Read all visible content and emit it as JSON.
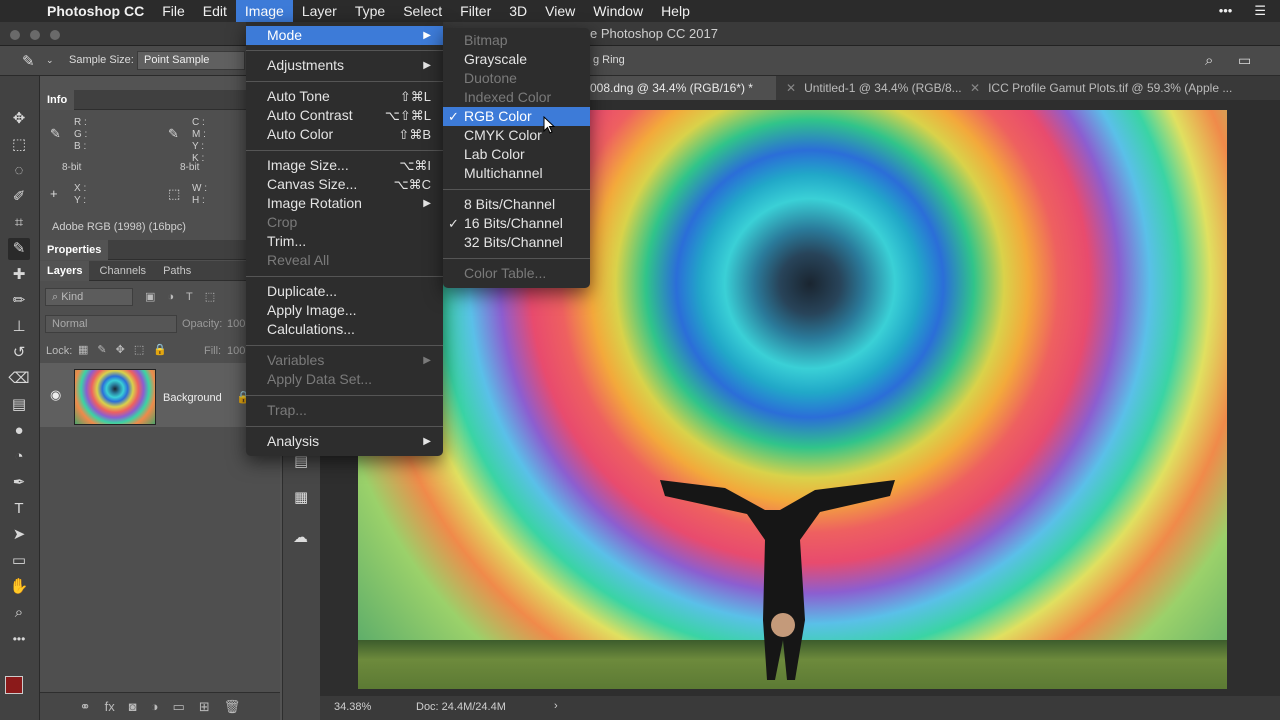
{
  "menubar": {
    "app": "Photoshop CC",
    "items": [
      "File",
      "Edit",
      "Image",
      "Layer",
      "Type",
      "Select",
      "Filter",
      "3D",
      "View",
      "Window",
      "Help"
    ],
    "active": "Image"
  },
  "titlebar": {
    "title": "e Photoshop CC 2017"
  },
  "options": {
    "sample_size_label": "Sample Size:",
    "sample_size_value": "Point Sample",
    "ring_label": "g Ring"
  },
  "tabs": [
    {
      "label": "008.dng @ 34.4% (RGB/16*) *",
      "active": true
    },
    {
      "label": "Untitled-1 @ 34.4% (RGB/8...",
      "active": false
    },
    {
      "label": "ICC Profile Gamut Plots.tif @ 59.3% (Apple ...",
      "active": false
    }
  ],
  "info_panel": {
    "tab": "Info",
    "rgb": "R :\nG :\nB :",
    "cmyk": "C :\nM :\nY :\nK :",
    "bit1": "8-bit",
    "bit2": "8-bit",
    "xy": "X :\nY :",
    "wh": "W :\nH :",
    "profile": "Adobe RGB (1998) (16bpc)"
  },
  "properties_tab": "Properties",
  "layers_panel": {
    "tabs": [
      "Layers",
      "Channels",
      "Paths"
    ],
    "kind_label": "Kind",
    "blend_mode": "Normal",
    "opacity_label": "Opacity:",
    "opacity_value": "100",
    "lock_label": "Lock:",
    "fill_label": "Fill:",
    "fill_value": "100",
    "layer_name": "Background"
  },
  "image_menu": {
    "items": [
      {
        "label": "Mode",
        "submenu": true,
        "highlighted": true
      },
      {
        "label": "Adjustments",
        "submenu": true
      },
      {
        "label": "Auto Tone",
        "shortcut": "⇧⌘L"
      },
      {
        "label": "Auto Contrast",
        "shortcut": "⌥⇧⌘L"
      },
      {
        "label": "Auto Color",
        "shortcut": "⇧⌘B"
      },
      {
        "label": "Image Size...",
        "shortcut": "⌥⌘I"
      },
      {
        "label": "Canvas Size...",
        "shortcut": "⌥⌘C"
      },
      {
        "label": "Image Rotation",
        "submenu": true
      },
      {
        "label": "Crop",
        "disabled": true
      },
      {
        "label": "Trim..."
      },
      {
        "label": "Reveal All",
        "disabled": true
      },
      {
        "label": "Duplicate..."
      },
      {
        "label": "Apply Image..."
      },
      {
        "label": "Calculations..."
      },
      {
        "label": "Variables",
        "submenu": true,
        "disabled": true
      },
      {
        "label": "Apply Data Set...",
        "disabled": true
      },
      {
        "label": "Trap...",
        "disabled": true
      },
      {
        "label": "Analysis",
        "submenu": true
      }
    ]
  },
  "mode_submenu": {
    "items": [
      {
        "label": "Bitmap",
        "disabled": true
      },
      {
        "label": "Grayscale"
      },
      {
        "label": "Duotone",
        "disabled": true
      },
      {
        "label": "Indexed Color",
        "disabled": true
      },
      {
        "label": "RGB Color",
        "checked": true,
        "highlighted": true
      },
      {
        "label": "CMYK Color"
      },
      {
        "label": "Lab Color"
      },
      {
        "label": "Multichannel"
      },
      {
        "label": "8 Bits/Channel"
      },
      {
        "label": "16 Bits/Channel",
        "checked": true
      },
      {
        "label": "32 Bits/Channel"
      },
      {
        "label": "Color Table...",
        "disabled": true
      }
    ]
  },
  "status": {
    "zoom": "34.38%",
    "doc": "Doc: 24.4M/24.4M",
    "arrow": "›"
  },
  "colors": {
    "accent": "#3d7bd8",
    "foreground_swatch": "#8b1a1a",
    "background_swatch": "#ffffff"
  }
}
